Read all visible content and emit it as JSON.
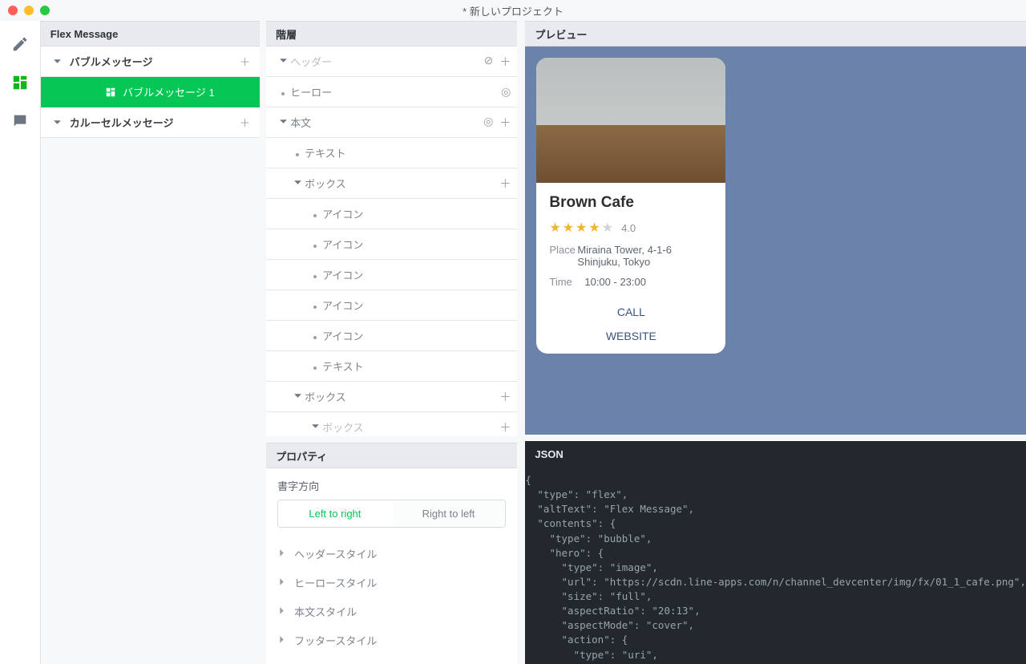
{
  "window": {
    "title": "* 新しいプロジェクト"
  },
  "rail": {
    "pencil": "pencil",
    "grid": "grid",
    "chat": "chat"
  },
  "flex": {
    "header": "Flex Message",
    "bubble_group": "バブルメッセージ",
    "bubble_item": "バブルメッセージ 1",
    "carousel_group": "カルーセルメッセージ"
  },
  "hier": {
    "header": "階層",
    "rows": {
      "r0": "ヘッダー",
      "r1": "ヒーロー",
      "r2": "本文",
      "r3": "テキスト",
      "r4": "ボックス",
      "r5": "アイコン",
      "r6": "アイコン",
      "r7": "アイコン",
      "r8": "アイコン",
      "r9": "アイコン",
      "r10": "テキスト",
      "r11": "ボックス",
      "r12": "ボックス"
    }
  },
  "props": {
    "header": "プロパティ",
    "writing_label": "書字方向",
    "ltr": "Left to right",
    "rtl": "Right to left",
    "header_style": "ヘッダースタイル",
    "hero_style": "ヒーロースタイル",
    "body_style": "本文スタイル",
    "footer_style": "フッタースタイル"
  },
  "preview": {
    "header": "プレビュー",
    "card": {
      "title": "Brown Cafe",
      "rating": "4.0",
      "place_k": "Place",
      "place_v": "Miraina Tower, 4-1-6 Shinjuku, Tokyo",
      "time_k": "Time",
      "time_v": "10:00 - 23:00",
      "btn_call": "CALL",
      "btn_web": "WEBSITE"
    }
  },
  "json": {
    "header": "JSON",
    "code": "{\n  \"type\": \"flex\",\n  \"altText\": \"Flex Message\",\n  \"contents\": {\n    \"type\": \"bubble\",\n    \"hero\": {\n      \"type\": \"image\",\n      \"url\": \"https://scdn.line-apps.com/n/channel_devcenter/img/fx/01_1_cafe.png\",\n      \"size\": \"full\",\n      \"aspectRatio\": \"20:13\",\n      \"aspectMode\": \"cover\",\n      \"action\": {\n        \"type\": \"uri\",\n        \"label\": \"Line\",\n        \"uri\": \"https://linecorp.com/\""
  }
}
